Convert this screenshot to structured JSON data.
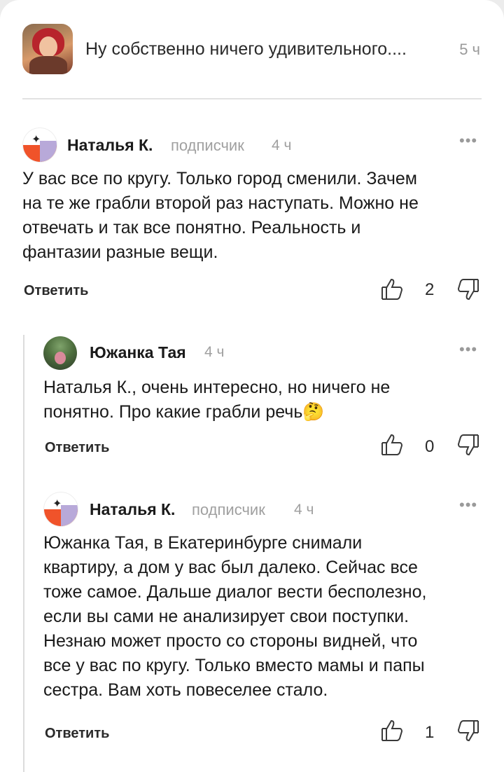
{
  "thread": {
    "title": "Ну собственно ничего удивительного....",
    "time": "5 ч"
  },
  "comments": [
    {
      "author": "Наталья К.",
      "badge": "подписчик",
      "time": "4 ч",
      "text_lines": [
        "У вас все по кругу. Только город сменили.    Зачем",
        "на те же грабли второй раз наступать.  Можно не",
        "отвечать и так все понятно. Реальность и",
        "фантазии разные вещи."
      ],
      "reply_label": "Ответить",
      "likes": "2",
      "more_icon": "more-dots-icon"
    },
    {
      "author": "Южанка Тая",
      "time": "4 ч",
      "text_lines": [
        "Наталья К., очень интересно, но ничего не",
        "понятно. Про какие грабли речь🤔"
      ],
      "reply_label": "Ответить",
      "likes": "0",
      "more_icon": "more-dots-icon"
    },
    {
      "author": "Наталья К.",
      "badge": "подписчик",
      "time": "4 ч",
      "text_lines": [
        "Южанка Тая,    в Екатеринбурге   снимали",
        "квартиру, а дом у вас был далеко. Сейчас все",
        "тоже самое.   Дальше диалог вести бесполезно,",
        "если вы сами не анализирует свои поступки.",
        "Незнаю может просто со стороны видней, что",
        "все у вас по кругу.  Только вместо мамы и папы",
        "сестра. Вам хоть повеселее стало."
      ],
      "reply_label": "Ответить",
      "likes": "1",
      "more_icon": "more-dots-icon"
    }
  ],
  "icons": {
    "like": "thumb-up-icon",
    "dislike": "thumb-down-icon"
  },
  "colors": {
    "brand_orange": "#f0532a",
    "brand_lilac": "#b8a9d9",
    "muted_text": "#a0a0a0"
  }
}
